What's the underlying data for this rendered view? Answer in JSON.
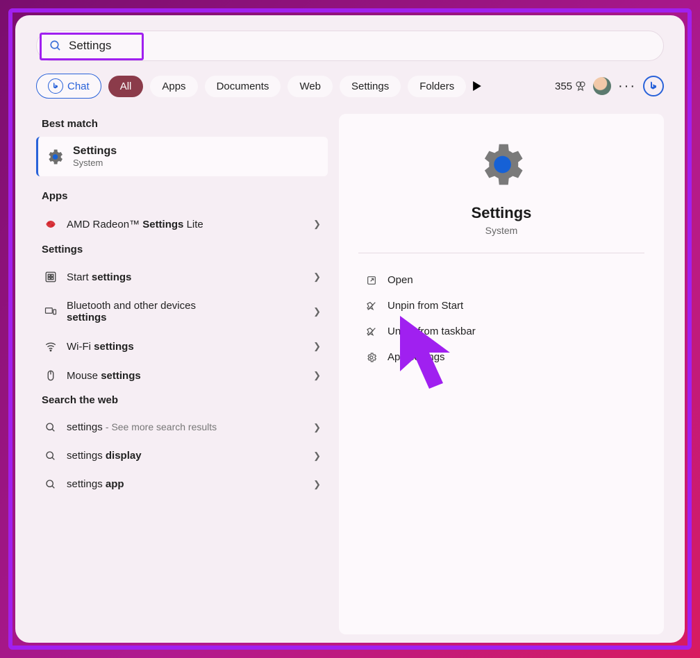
{
  "search": {
    "value": "Settings"
  },
  "tabs": {
    "chat": "Chat",
    "all": "All",
    "apps": "Apps",
    "documents": "Documents",
    "web": "Web",
    "settings": "Settings",
    "folders": "Folders"
  },
  "rewards": {
    "count": "355"
  },
  "left": {
    "best_match_label": "Best match",
    "best_match_title": "Settings",
    "best_match_sub": "System",
    "apps_label": "Apps",
    "app1_prefix": "AMD Radeon™ ",
    "app1_bold": "Settings",
    "app1_suffix": " Lite",
    "settings_label": "Settings",
    "s1_prefix": "Start ",
    "s1_bold": "settings",
    "s2_line1": "Bluetooth and other devices",
    "s2_bold": "settings",
    "s3_prefix": "Wi-Fi ",
    "s3_bold": "settings",
    "s4_prefix": "Mouse ",
    "s4_bold": "settings",
    "web_label": "Search the web",
    "w1_text": "settings",
    "w1_sub": "See more search results",
    "w2_text": "settings ",
    "w2_bold": "display",
    "w3_text": "settings ",
    "w3_bold": "app"
  },
  "right": {
    "title": "Settings",
    "sub": "System",
    "actions": {
      "open": "Open",
      "unpin_start": "Unpin from Start",
      "unpin_taskbar": "Unpin from taskbar",
      "app_settings": "App settings"
    }
  }
}
